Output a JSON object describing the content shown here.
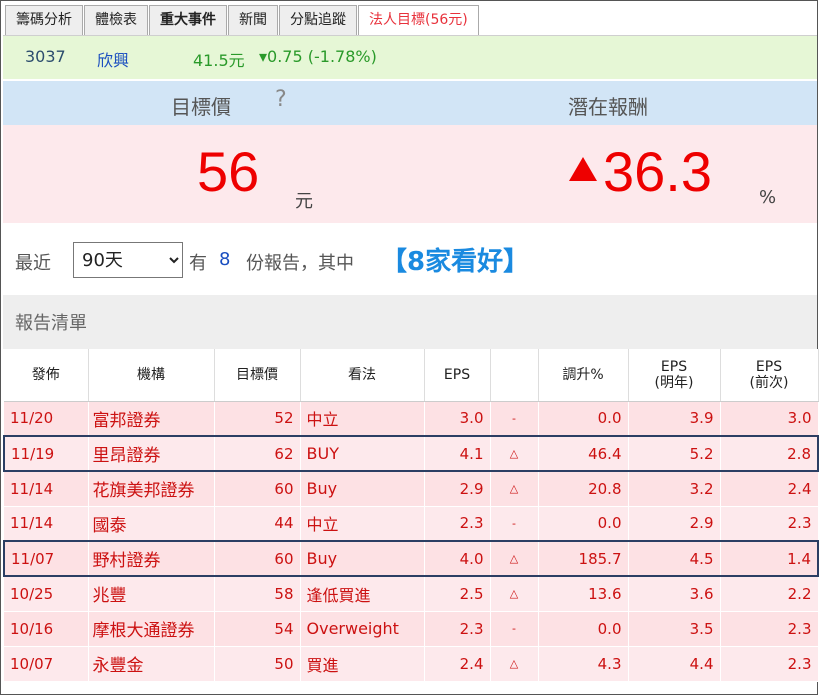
{
  "tabs": [
    {
      "label": "籌碼分析",
      "bold": false,
      "active": false
    },
    {
      "label": "體檢表",
      "bold": false,
      "active": false
    },
    {
      "label": "重大事件",
      "bold": true,
      "active": false
    },
    {
      "label": "新聞",
      "bold": false,
      "active": false
    },
    {
      "label": "分點追蹤",
      "bold": false,
      "active": false
    },
    {
      "label": "法人目標(56元)",
      "bold": false,
      "active": true
    }
  ],
  "stock": {
    "code": "3037",
    "name": "欣興",
    "price": "41.5元",
    "change": "▾0.75 (-1.78%)"
  },
  "target": {
    "label_price": "目標價",
    "help": "?",
    "label_return": "潛在報酬",
    "price": "56",
    "price_unit": "元",
    "return": "36.3",
    "return_unit": "%"
  },
  "period": {
    "prefix": "最近",
    "selected": "90天",
    "has": "有",
    "count": "8",
    "suffix": "份報告，其中",
    "highlight": "【8家看好】"
  },
  "report_list_title": "報告清單",
  "table": {
    "headers": [
      "發佈",
      "機構",
      "目標價",
      "看法",
      "EPS",
      "",
      "調升%",
      "EPS\n(明年)",
      "EPS\n(前次)"
    ],
    "rows": [
      {
        "date": "11/20",
        "org": "富邦證券",
        "target": "52",
        "view": "中立",
        "eps": "3.0",
        "arrow": "-",
        "up": "0.0",
        "eps_next": "3.9",
        "eps_prev": "3.0",
        "framed": false
      },
      {
        "date": "11/19",
        "org": "里昂證券",
        "target": "62",
        "view": "BUY",
        "eps": "4.1",
        "arrow": "△",
        "up": "46.4",
        "eps_next": "5.2",
        "eps_prev": "2.8",
        "framed": true
      },
      {
        "date": "11/14",
        "org": "花旗美邦證券",
        "target": "60",
        "view": "Buy",
        "eps": "2.9",
        "arrow": "△",
        "up": "20.8",
        "eps_next": "3.2",
        "eps_prev": "2.4",
        "framed": false
      },
      {
        "date": "11/14",
        "org": "國泰",
        "target": "44",
        "view": "中立",
        "eps": "2.3",
        "arrow": "-",
        "up": "0.0",
        "eps_next": "2.9",
        "eps_prev": "2.3",
        "framed": false
      },
      {
        "date": "11/07",
        "org": "野村證券",
        "target": "60",
        "view": "Buy",
        "eps": "4.0",
        "arrow": "△",
        "up": "185.7",
        "eps_next": "4.5",
        "eps_prev": "1.4",
        "framed": true
      },
      {
        "date": "10/25",
        "org": "兆豐",
        "target": "58",
        "view": "逢低買進",
        "eps": "2.5",
        "arrow": "△",
        "up": "13.6",
        "eps_next": "3.6",
        "eps_prev": "2.2",
        "framed": false
      },
      {
        "date": "10/16",
        "org": "摩根大通證券",
        "target": "54",
        "view": "Overweight",
        "eps": "2.3",
        "arrow": "-",
        "up": "0.0",
        "eps_next": "3.5",
        "eps_prev": "2.3",
        "framed": false
      },
      {
        "date": "10/07",
        "org": "永豐金",
        "target": "50",
        "view": "買進",
        "eps": "2.4",
        "arrow": "△",
        "up": "4.3",
        "eps_next": "4.4",
        "eps_prev": "2.3",
        "framed": false
      }
    ]
  },
  "colors": {
    "up_red": "#ee0000",
    "down_green": "#2a9a2a",
    "accent_blue": "#1a8ae0",
    "row_bg": "#fde1e4",
    "frame_navy": "#2c3e63"
  }
}
